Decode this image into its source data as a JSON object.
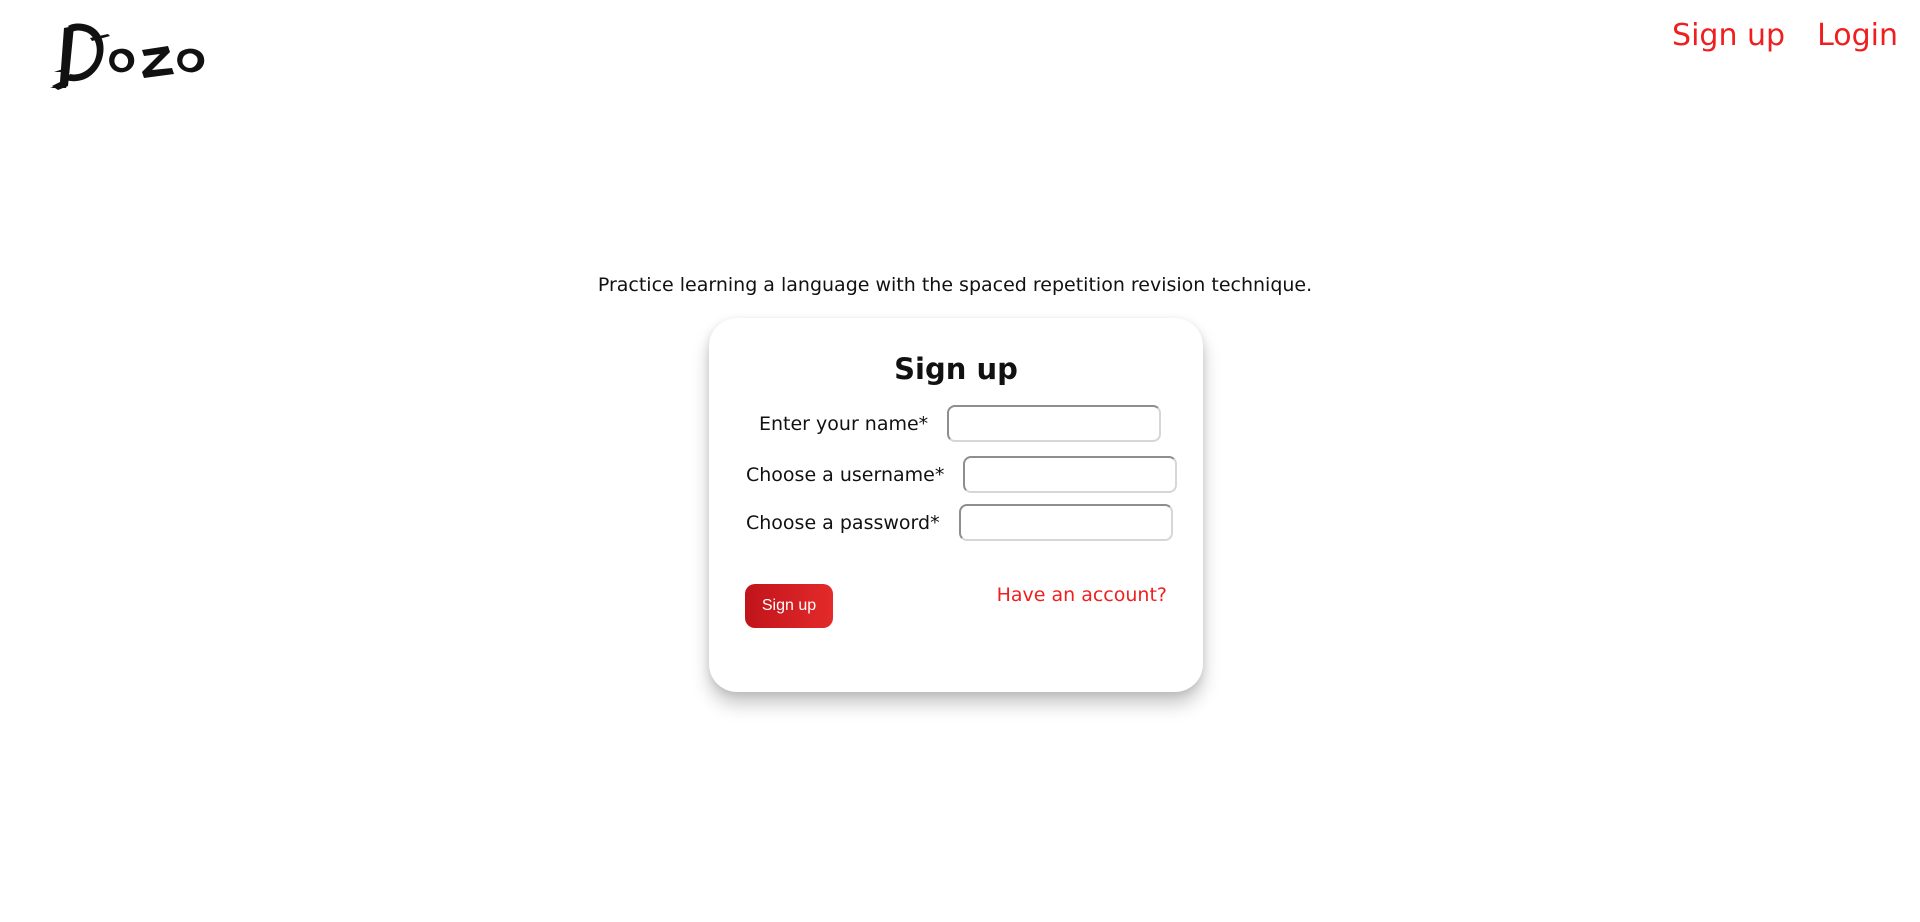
{
  "header": {
    "logo_text": "Dozo",
    "nav": {
      "signup_label": "Sign up",
      "login_label": "Login"
    }
  },
  "main": {
    "tagline": "Practice learning a language with the spaced repetition revision technique.",
    "form": {
      "title": "Sign up",
      "fields": [
        {
          "label": "Enter your name*",
          "value": "",
          "placeholder": ""
        },
        {
          "label": "Choose a username*",
          "value": "",
          "placeholder": ""
        },
        {
          "label": "Choose a password*",
          "value": "",
          "placeholder": ""
        }
      ],
      "submit_label": "Sign up",
      "have_account_label": "Have an account?"
    }
  },
  "colors": {
    "accent": "#ef1f1f",
    "button_start": "#c0141b",
    "button_end": "#e42a2a",
    "background": "#ffffff"
  },
  "icons": {
    "logo": "dozo-brush-logo"
  }
}
